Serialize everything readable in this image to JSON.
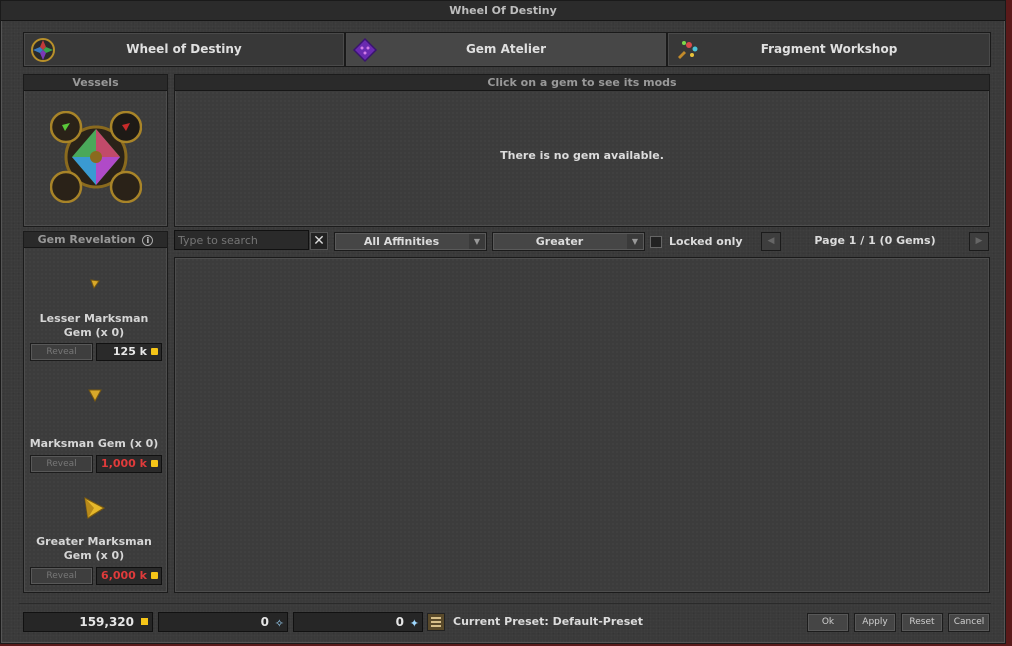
{
  "window": {
    "title": "Wheel Of Destiny"
  },
  "tabs": [
    {
      "label": "Wheel of Destiny",
      "icon": "wheel-icon"
    },
    {
      "label": "Gem Atelier",
      "icon": "gem-atelier-icon"
    },
    {
      "label": "Fragment Workshop",
      "icon": "fragment-icon"
    }
  ],
  "vessels": {
    "title": "Vessels"
  },
  "mods": {
    "title": "Click on a gem to see its mods",
    "empty_message": "There is no gem available."
  },
  "revelation": {
    "title": "Gem Revelation",
    "gems": [
      {
        "name_line1": "Lesser Marksman",
        "name_line2": "Gem (x 0)",
        "reveal_label": "Reveal",
        "price": "125 k",
        "affordable": true
      },
      {
        "name_line1": "",
        "name_line2": "Marksman Gem (x 0)",
        "reveal_label": "Reveal",
        "price": "1,000 k",
        "affordable": false
      },
      {
        "name_line1": "Greater Marksman",
        "name_line2": "Gem (x 0)",
        "reveal_label": "Reveal",
        "price": "6,000 k",
        "affordable": false
      }
    ]
  },
  "filters": {
    "search_placeholder": "Type to search",
    "affinity": "All Affinities",
    "quality": "Greater",
    "locked_label": "Locked only",
    "locked_checked": false,
    "page_info": "Page 1 / 1 (0 Gems)"
  },
  "footer": {
    "gold": "159,320",
    "fragments_lesser": "0",
    "fragments_greater": "0",
    "preset_label": "Current Preset: Default-Preset",
    "buttons": {
      "ok": "Ok",
      "apply": "Apply",
      "reset": "Reset",
      "cancel": "Cancel"
    }
  },
  "colors": {
    "price_red": "#e03b3b",
    "coin": "#f5c518",
    "gold_gem": "#d9a92a"
  }
}
